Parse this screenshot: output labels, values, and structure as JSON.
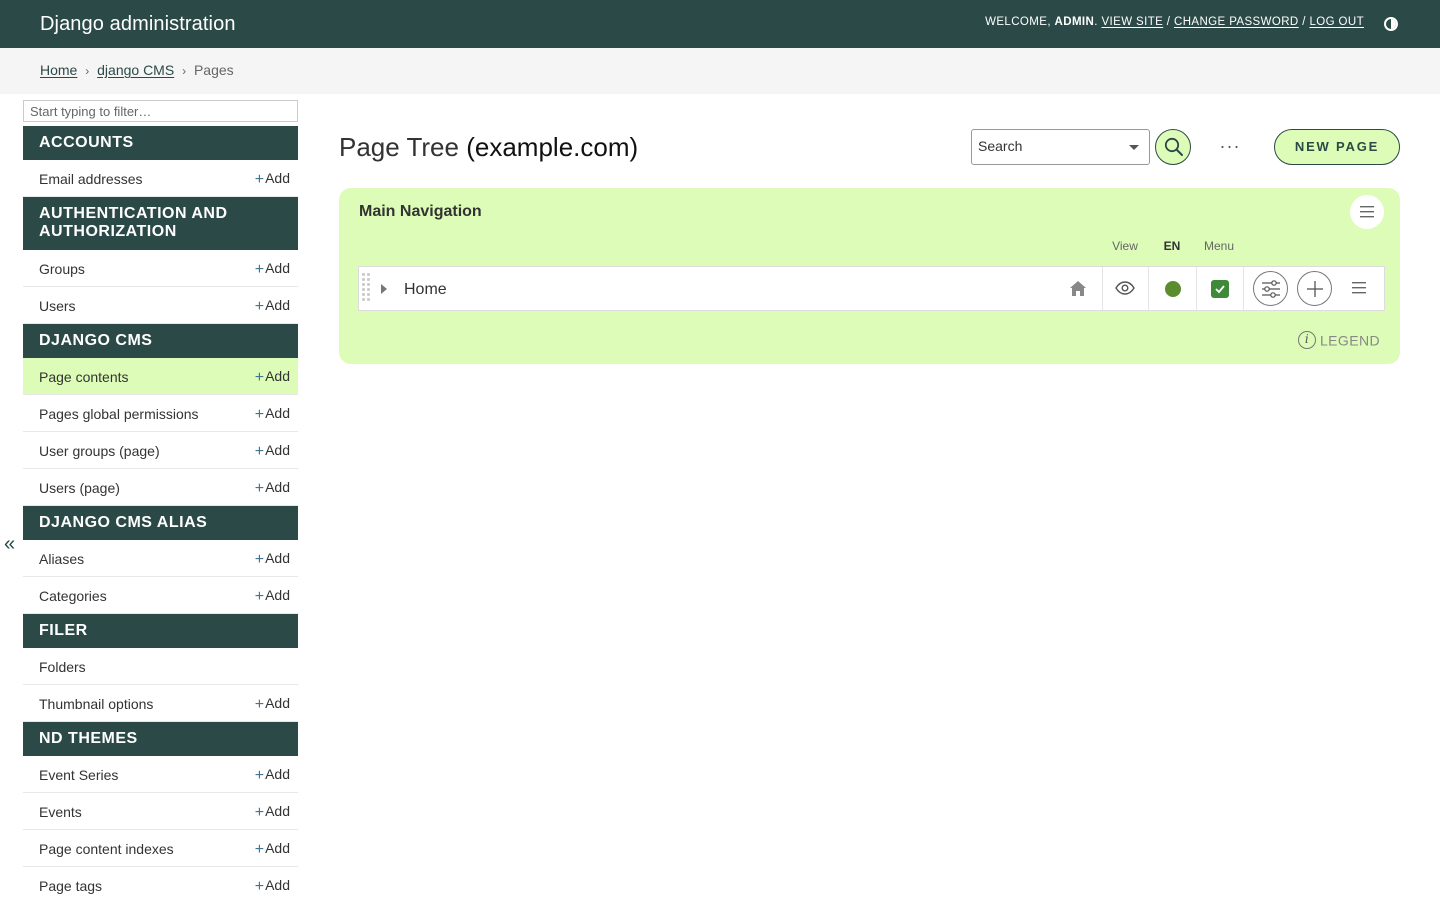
{
  "header": {
    "brand": "Django administration",
    "welcome": "WELCOME,",
    "user": "ADMIN",
    "view_site": "VIEW SITE",
    "change_password": "CHANGE PASSWORD",
    "log_out": "LOG OUT",
    "bg_color": "#2b4a47"
  },
  "breadcrumbs": {
    "home": "Home",
    "app": "django CMS",
    "current": "Pages",
    "sep": "›"
  },
  "sidebar": {
    "filter_placeholder": "Start typing to filter…",
    "add_label": "Add",
    "collapse": "«",
    "sections": [
      {
        "title": "Accounts",
        "items": [
          {
            "name": "Email addresses",
            "add": true
          }
        ]
      },
      {
        "title": "Authentication and Authorization",
        "items": [
          {
            "name": "Groups",
            "add": true
          },
          {
            "name": "Users",
            "add": true
          }
        ]
      },
      {
        "title": "django CMS",
        "items": [
          {
            "name": "Page contents",
            "add": true,
            "active": true
          },
          {
            "name": "Pages global permissions",
            "add": true
          },
          {
            "name": "User groups (page)",
            "add": true
          },
          {
            "name": "Users (page)",
            "add": true
          }
        ]
      },
      {
        "title": "django CMS Alias",
        "items": [
          {
            "name": "Aliases",
            "add": true
          },
          {
            "name": "Categories",
            "add": true
          }
        ]
      },
      {
        "title": "Filer",
        "items": [
          {
            "name": "Folders",
            "add": false
          },
          {
            "name": "Thumbnail options",
            "add": true
          }
        ]
      },
      {
        "title": "ND Themes",
        "items": [
          {
            "name": "Event Series",
            "add": true
          },
          {
            "name": "Events",
            "add": true
          },
          {
            "name": "Page content indexes",
            "add": true
          },
          {
            "name": "Page tags",
            "add": true
          }
        ]
      }
    ]
  },
  "main": {
    "title": "Page Tree",
    "site": "(example.com)",
    "search_placeholder": "Search",
    "more": "···",
    "new_page": "NEW PAGE",
    "accent_color": "#dcfcb7",
    "tree": {
      "title": "Main Navigation",
      "col_view": "View",
      "col_lang": "EN",
      "col_menu": "Menu",
      "row_title": "Home",
      "legend": "LEGEND",
      "info_glyph": "i"
    }
  }
}
